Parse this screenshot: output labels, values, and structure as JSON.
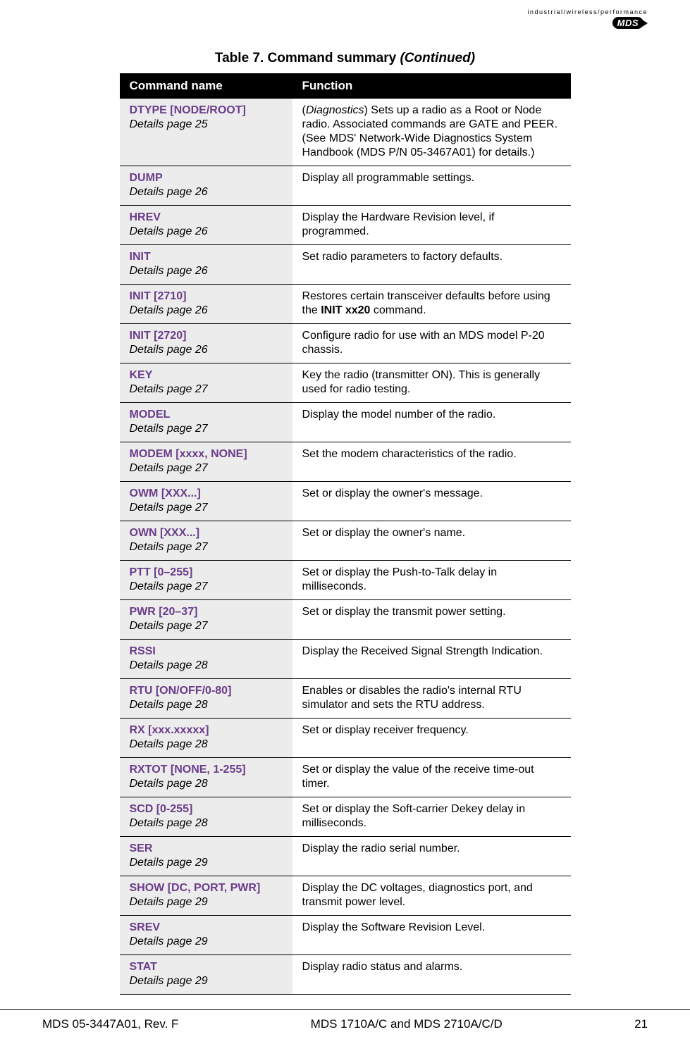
{
  "header": {
    "tagline": "industrial/wireless/performance",
    "logo_text": "MDS"
  },
  "caption": {
    "prefix": "Table 7. Command summary ",
    "suffix": "(Continued)"
  },
  "cols": {
    "cmd": "Command name",
    "func": "Function"
  },
  "rows": [
    {
      "cmd": "DTYPE [NODE/ROOT]",
      "page": "Details page 25",
      "func": "(<em>Diagnostics</em>) Sets up a radio as a Root or Node radio. Associated commands are GATE and PEER. (See MDS' Network-Wide Diagnostics System Handbook (MDS P/N 05-3467A01) for details.)"
    },
    {
      "cmd": "DUMP",
      "page": "Details page 26",
      "func": "Display all programmable settings."
    },
    {
      "cmd": "HREV",
      "page": "Details page 26",
      "func": "Display the Hardware Revision level, if programmed."
    },
    {
      "cmd": "INIT",
      "page": "Details page 26",
      "func": "Set radio parameters to factory defaults."
    },
    {
      "cmd": "INIT [2710]",
      "page": "Details page 26",
      "func": "Restores certain transceiver defaults before using the <b>INIT xx20</b> command."
    },
    {
      "cmd": "INIT [2720]",
      "page": "Details page 26",
      "func": "Configure radio for use with an MDS model P-20 chassis."
    },
    {
      "cmd": "KEY",
      "page": "Details page 27",
      "func": "Key the radio (transmitter ON). This is generally used for radio testing."
    },
    {
      "cmd": "MODEL",
      "page": "Details page 27",
      "func": "Display the model number of the radio."
    },
    {
      "cmd": "MODEM [xxxx, NONE]",
      "page": "Details page 27",
      "func": "Set the modem characteristics of the radio."
    },
    {
      "cmd": "OWM [XXX...]",
      "page": "Details page 27",
      "func": "Set or display the owner's message."
    },
    {
      "cmd": "OWN [XXX...]",
      "page": "Details page 27",
      "func": "Set or display the owner's name."
    },
    {
      "cmd": "PTT [0–255]",
      "page": "Details page 27",
      "func": "Set or display the Push-to-Talk delay in milliseconds."
    },
    {
      "cmd": "PWR [20–37]",
      "page": "Details page 27",
      "func": "Set or display the transmit power setting."
    },
    {
      "cmd": "RSSI",
      "page": "Details page 28",
      "func": "Display the Received Signal Strength Indication."
    },
    {
      "cmd": "RTU [ON/OFF/0-80]",
      "page": "Details page 28",
      "func": "Enables or disables the radio's internal RTU simulator and sets the RTU address."
    },
    {
      "cmd": "RX [xxx.xxxxx]",
      "page": "Details page 28",
      "func": "Set or display receiver frequency."
    },
    {
      "cmd": "RXTOT [NONE, 1-255]",
      "page": "Details page 28",
      "func": "Set or display the value of the receive time-out timer."
    },
    {
      "cmd": "SCD [0-255]",
      "page": "Details page 28",
      "func": "Set or display the Soft-carrier Dekey delay in milliseconds."
    },
    {
      "cmd": "SER",
      "page": "Details page 29",
      "func": "Display the radio serial number."
    },
    {
      "cmd": "SHOW [DC, PORT, PWR]",
      "page": "Details page 29",
      "func": "Display the DC voltages, diagnostics port, and transmit power level."
    },
    {
      "cmd": "SREV",
      "page": "Details page 29",
      "func": "Display the Software Revision Level."
    },
    {
      "cmd": "STAT",
      "page": "Details page 29",
      "func": "Display radio status and alarms."
    }
  ],
  "footer": {
    "left": "MDS 05-3447A01, Rev. F",
    "center": "MDS 1710A/C and MDS 2710A/C/D",
    "right": "21"
  }
}
